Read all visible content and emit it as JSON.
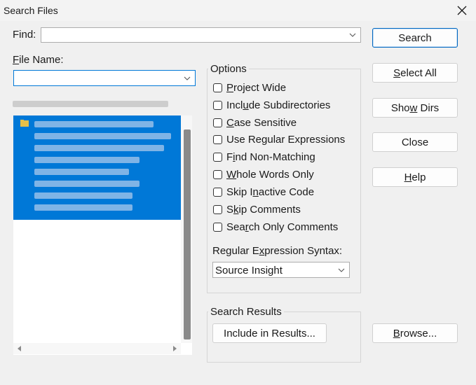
{
  "window": {
    "title": "Search Files"
  },
  "find": {
    "label": "Find:",
    "value": ""
  },
  "file_name": {
    "label": "File Name:",
    "value": ""
  },
  "options": {
    "title": "Options",
    "checkboxes": [
      {
        "label": "Project Wide",
        "checked": false
      },
      {
        "label": "Include Subdirectories",
        "checked": false
      },
      {
        "label": "Case Sensitive",
        "checked": false
      },
      {
        "label": "Use Regular Expressions",
        "checked": false
      },
      {
        "label": "Find Non-Matching",
        "checked": false
      },
      {
        "label": "Whole Words Only",
        "checked": false
      },
      {
        "label": "Skip Inactive Code",
        "checked": false
      },
      {
        "label": "Skip Comments",
        "checked": false
      },
      {
        "label": "Search Only Comments",
        "checked": false
      }
    ],
    "regex_syntax_label": "Regular Expression Syntax:",
    "regex_syntax_value": "Source Insight"
  },
  "search_results": {
    "title": "Search Results",
    "include_button": "Include in Results..."
  },
  "buttons": {
    "search": "Search",
    "select_all": "Select All",
    "show_dirs": "Show Dirs",
    "close": "Close",
    "help": "Help",
    "browse": "Browse..."
  },
  "icons": {
    "close": "close-icon",
    "dropdown": "chevron-down-icon",
    "folder": "folder-icon",
    "scroll_left": "scroll-left-icon",
    "scroll_right": "scroll-right-icon"
  },
  "colors": {
    "selection": "#0078d7",
    "default_button_border": "#0067c0",
    "background": "#f0f0f0"
  }
}
